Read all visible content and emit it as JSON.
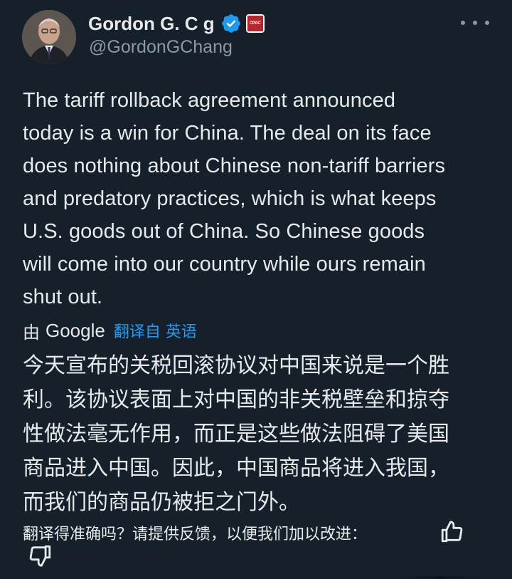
{
  "author": {
    "display_name": "Gordon G. C      g",
    "handle": "@GordonGChang",
    "verified_icon": "verified-badge-icon",
    "affiliation_badge_text": "CPAC",
    "avatar": "avatar-photo"
  },
  "menu": {
    "icon": "more-horizontal-icon"
  },
  "tweet": {
    "text": "The tariff rollback agreement announced\ntoday is a win for China. The deal on its face\ndoes nothing about Chinese non-tariff barriers\nand predatory practices, which is what keeps\nU.S. goods out of China. So Chinese goods\nwill come into our country while ours remain\nshut out."
  },
  "translation": {
    "by_label": "由",
    "provider": "Google",
    "link_label": "翻译自 英语",
    "text": "今天宣布的关税回滚协议对中国来说是一个胜\n利。该协议表面上对中国的非关税壁垒和掠夺\n性做法毫无作用，而正是这些做法阻碍了美国\n商品进入中国。因此，中国商品将进入我国，\n而我们的商品仍被拒之门外。"
  },
  "feedback": {
    "prompt": "翻译得准确吗？请提供反馈，以便我们加以改进：",
    "thumb_up_icon": "thumbs-up-icon",
    "thumb_down_icon": "thumbs-down-icon"
  },
  "colors": {
    "background": "#15202b",
    "text": "#e7e9ea",
    "secondary": "#8b98a5",
    "accent": "#1d9bf0"
  }
}
